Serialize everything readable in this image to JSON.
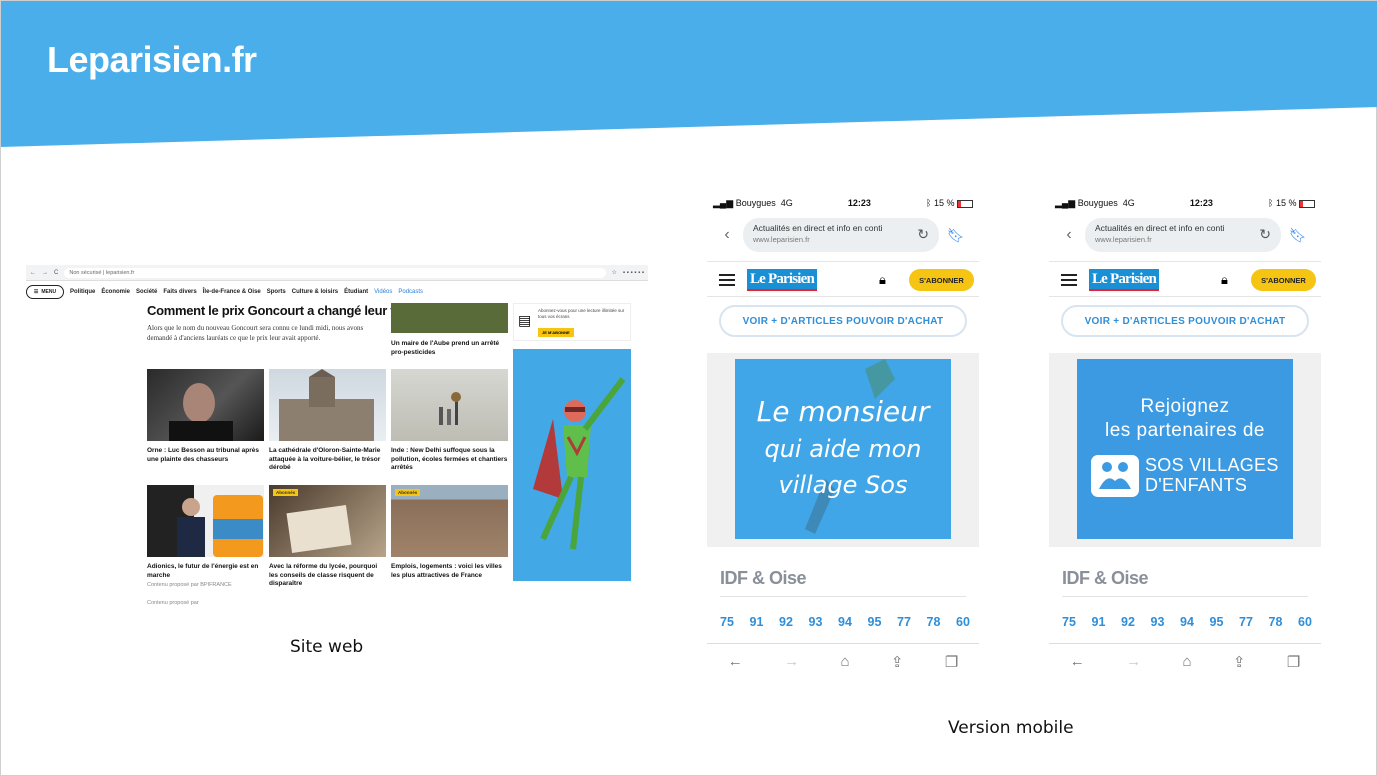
{
  "slide": {
    "title": "Leparisien.fr",
    "caption_web": "Site web",
    "caption_mobile": "Version mobile",
    "banner_color": "#4aaeeb"
  },
  "desktop": {
    "browser": {
      "security": "Non sécurisé",
      "url": "leparisien.fr"
    },
    "menu_label": "MENU",
    "nav": [
      "Politique",
      "Économie",
      "Société",
      "Faits divers",
      "Île-de-France & Oise",
      "Sports",
      "Culture & loisirs",
      "Étudiant",
      "Vidéos",
      "Podcasts"
    ],
    "headline": "Comment le prix Goncourt a changé leur vie",
    "lead": "Alors que le nom du nouveau Goncourt sera connu ce lundi midi, nous avons demandé à d'anciens lauréats ce que le prix leur avait apporté.",
    "top_right_caption": "Un maire de l'Aube prend un arrêté pro-pesticides",
    "tiles": [
      {
        "caption": "Orne : Luc Besson au tribunal après une plainte des chasseurs",
        "sub": "",
        "badge": ""
      },
      {
        "caption": "La cathédrale d'Oloron-Sainte-Marie attaquée à la voiture-bélier, le trésor dérobé",
        "sub": "",
        "badge": ""
      },
      {
        "caption": "Inde : New Delhi suffoque sous la pollution, écoles fermées et chantiers arrêtés",
        "sub": "",
        "badge": ""
      },
      {
        "caption": "Adionics, le futur de l'énergie est en marche",
        "sub": "Contenu proposé par BPIFRANCE",
        "badge": ""
      },
      {
        "caption": "Avec la réforme du lycée, pourquoi les conseils de classe risquent de disparaître",
        "sub": "",
        "badge": "Abonnés"
      },
      {
        "caption": "Emplois, logements : voici les villes les plus attractives de France",
        "sub": "",
        "badge": "Abonnés"
      }
    ],
    "sponsored_footer": "Contenu proposé par",
    "ad_top": {
      "text": "Abonnez-vous pour une lecture illimitée sur tous vos écrans",
      "button": "JE M'ABONNE"
    }
  },
  "phones": [
    {
      "status": {
        "carrier": "Bouygues",
        "network": "4G",
        "time": "12:23",
        "battery": "15 %"
      },
      "address": {
        "title": "Actualités en direct et info en conti",
        "url": "www.leparisien.fr"
      },
      "logo": "Le Parisien",
      "subscribe": "S'ABONNER",
      "more_button": "VOIR + D'ARTICLES POUVOIR D'ACHAT",
      "image_alt": "Le monsieur qui aide mon village Sos",
      "section": "IDF & Oise",
      "departments": [
        "75",
        "91",
        "92",
        "93",
        "94",
        "95",
        "77",
        "78",
        "60"
      ]
    },
    {
      "status": {
        "carrier": "Bouygues",
        "network": "4G",
        "time": "12:23",
        "battery": "15 %"
      },
      "address": {
        "title": "Actualités en direct et info en conti",
        "url": "www.leparisien.fr"
      },
      "logo": "Le Parisien",
      "subscribe": "S'ABONNER",
      "more_button": "VOIR + D'ARTICLES POUVOIR D'ACHAT",
      "ad": {
        "line1": "Rejoignez",
        "line2": "les partenaires de",
        "brand1": "SOS VILLAGES",
        "brand2": "D'ENFANTS"
      },
      "section": "IDF & Oise",
      "departments": [
        "75",
        "91",
        "92",
        "93",
        "94",
        "95",
        "77",
        "78",
        "60"
      ]
    }
  ]
}
